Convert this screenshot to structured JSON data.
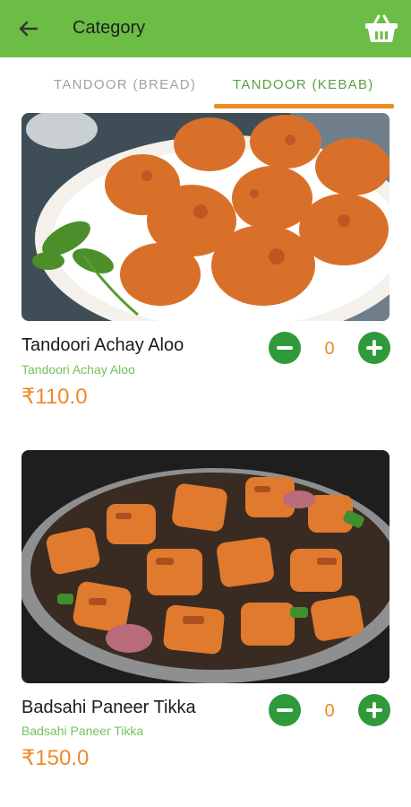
{
  "appbar": {
    "title": "Category",
    "back_icon": "arrow-left-icon",
    "cart_icon": "basket-icon",
    "color": "#6cbd45"
  },
  "tabs": [
    {
      "label": "TANDOOR (BREAD)",
      "selected": false
    },
    {
      "label": "TANDOOR (KEBAB)",
      "selected": true
    }
  ],
  "colors": {
    "accent": "#f0892b",
    "tab_selected": "#5b9f44",
    "tab_unselected": "#9aa3a6",
    "qty_button": "#2f9a3a",
    "subtitle": "#77c05a"
  },
  "items": [
    {
      "name": "Tandoori Achay Aloo",
      "subtitle": "Tandoori Achay Aloo",
      "price": "₹110.0",
      "quantity": "0",
      "image": "tandoori potatoes on a plate"
    },
    {
      "name": "Badsahi Paneer Tikka",
      "subtitle": "Badsahi Paneer Tikka",
      "price": "₹150.0",
      "quantity": "0",
      "image": "paneer tikka in a serving dish"
    }
  ]
}
